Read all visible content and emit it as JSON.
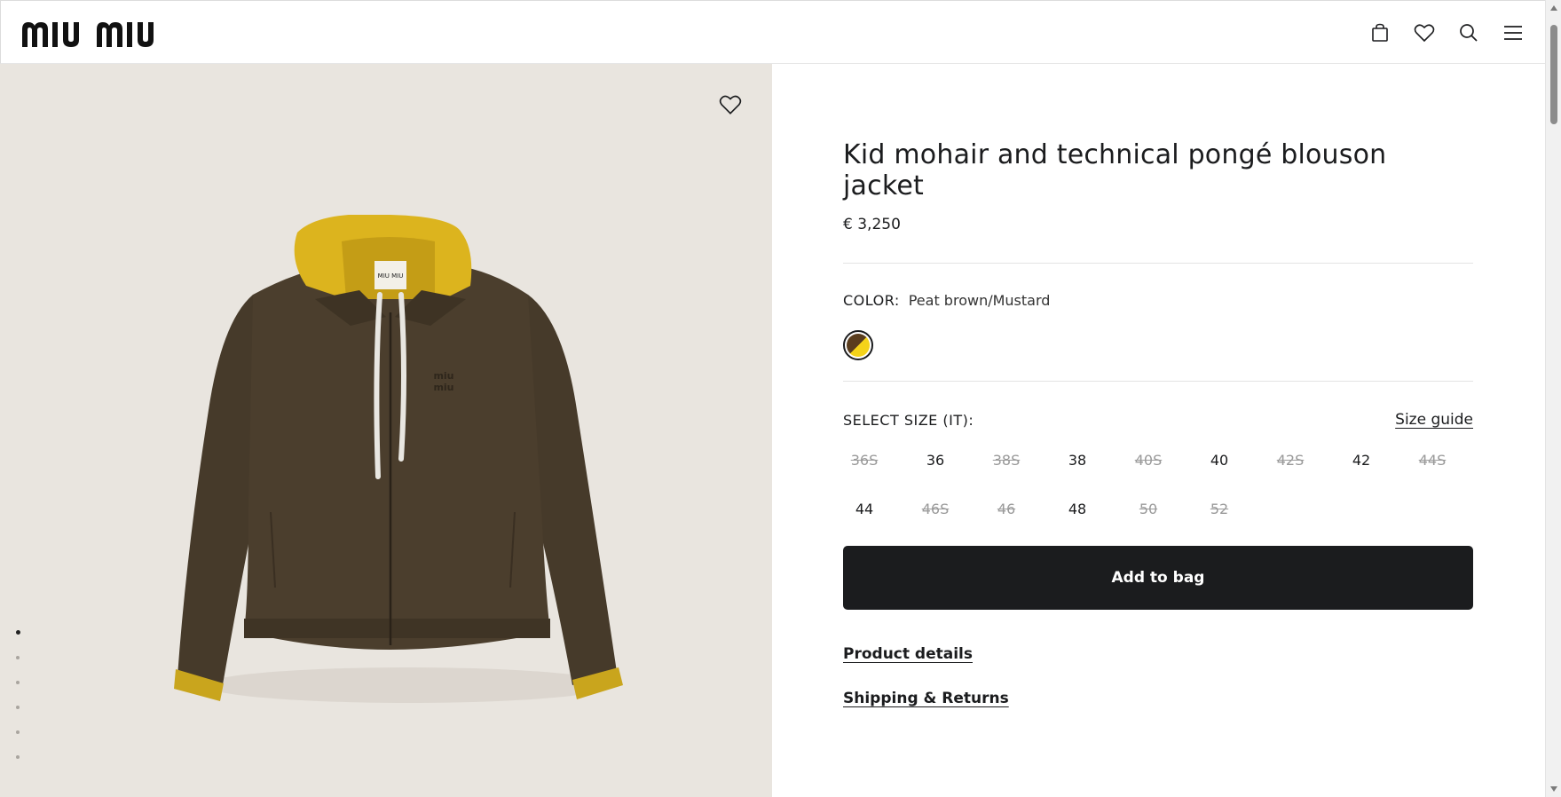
{
  "header": {
    "logo_text": "miu miu",
    "icons": [
      "bag-icon",
      "heart-icon",
      "search-icon",
      "menu-icon"
    ]
  },
  "gallery": {
    "background": "#e9e5df",
    "slide_count": 6,
    "active_slide": 1
  },
  "product": {
    "title": "Kid mohair and technical pongé blouson jacket",
    "price": "€ 3,250",
    "color_label": "COLOR:",
    "color_value": "Peat brown/Mustard",
    "swatch_colors": [
      "#5a3d1e",
      "#f4d31a"
    ],
    "size_label": "SELECT SIZE (IT):",
    "size_guide": "Size guide",
    "sizes": [
      {
        "label": "36S",
        "available": false
      },
      {
        "label": "36",
        "available": true
      },
      {
        "label": "38S",
        "available": false
      },
      {
        "label": "38",
        "available": true
      },
      {
        "label": "40S",
        "available": false
      },
      {
        "label": "40",
        "available": true
      },
      {
        "label": "42S",
        "available": false
      },
      {
        "label": "42",
        "available": true
      },
      {
        "label": "44S",
        "available": false
      },
      {
        "label": "44",
        "available": true
      },
      {
        "label": "46S",
        "available": false
      },
      {
        "label": "46",
        "available": false
      },
      {
        "label": "48",
        "available": true
      },
      {
        "label": "50",
        "available": false
      },
      {
        "label": "52",
        "available": false
      }
    ],
    "add_to_bag": "Add to bag",
    "product_details": "Product details",
    "shipping_returns": "Shipping & Returns"
  },
  "colors": {
    "button_bg": "#1b1c1e",
    "jacket_brown": "#4a3d2c",
    "hood_mustard": "#dcb41e"
  }
}
